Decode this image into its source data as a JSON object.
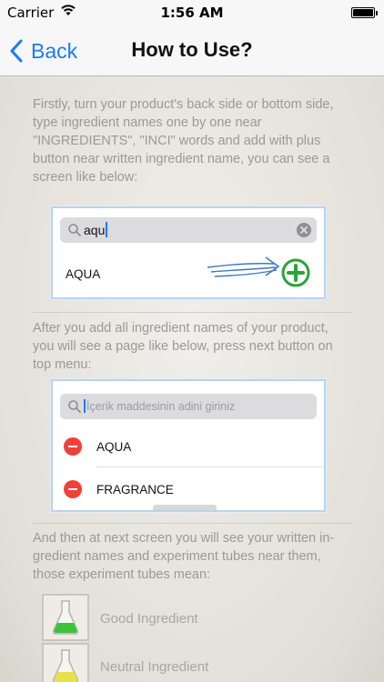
{
  "status_bar": {
    "carrier": "Carrier",
    "time": "1:56 AM"
  },
  "nav": {
    "back_label": "Back",
    "title": "How to Use?"
  },
  "content": {
    "para1": "Firstly, turn your product's back side or bottom side, type ingredient names one by one near \"INGREDIENTS\", \"INCI\" words and add with plus button near written ingredient name, you can see a screen like below:",
    "example1": {
      "search_value": "aqu",
      "result_item": "AQUA"
    },
    "para2": "After you add all ingredient names of your product, you will see a page like below, press next button on top menu:",
    "example2": {
      "search_placeholder": "İçerik maddesinin adini giriniz",
      "items": [
        "AQUA",
        "FRAGRANCE"
      ]
    },
    "para3": "And then at next screen you will see your written in-gredient names and experiment tubes near them, those experiment tubes mean:",
    "legend": [
      {
        "label": "Good Ingredient",
        "color": "#3cc23c"
      },
      {
        "label": "Neutral Ingredient",
        "color": "#e8e24a"
      }
    ]
  },
  "colors": {
    "accent": "#1a7cf5",
    "plus": "#2aa33a",
    "remove": "#f0403a"
  }
}
